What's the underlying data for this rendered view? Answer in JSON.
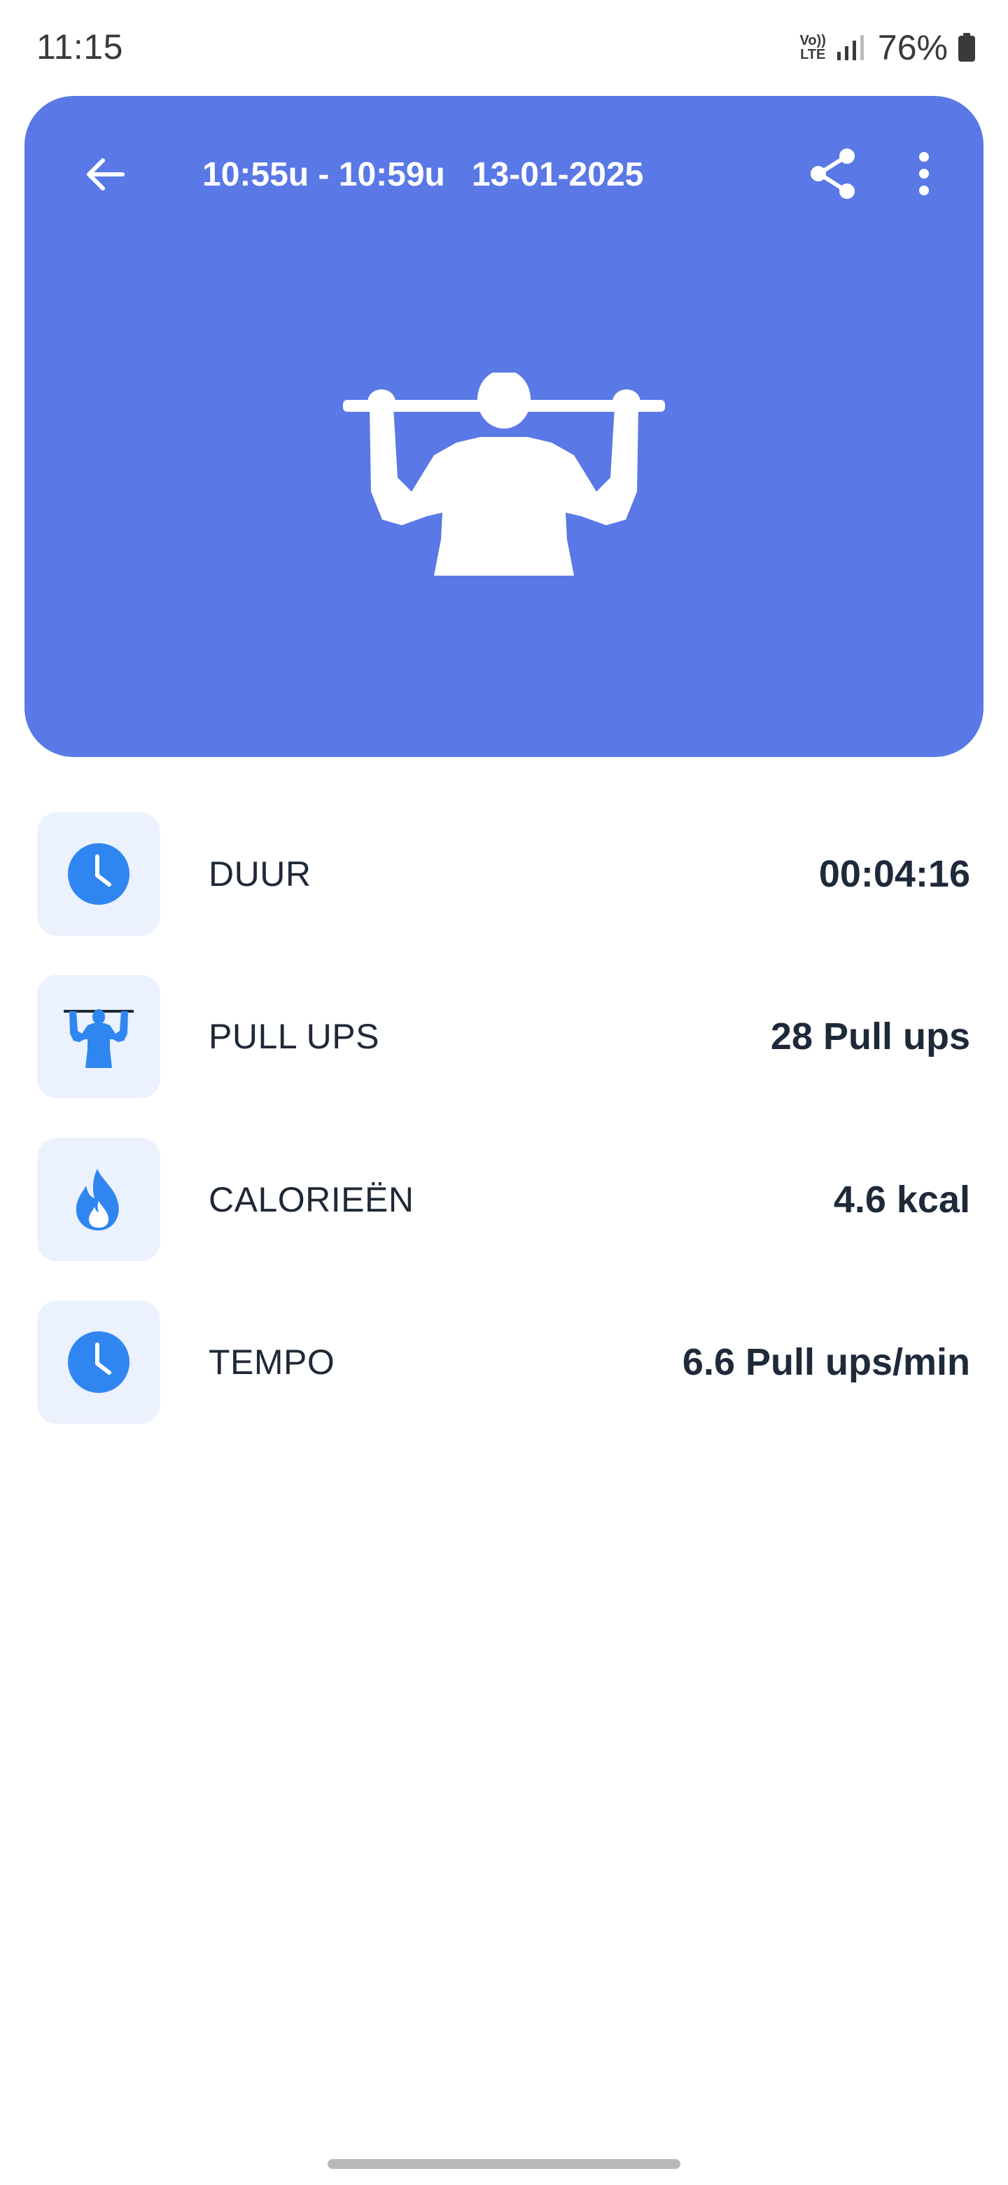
{
  "status_bar": {
    "time": "11:15",
    "volte_top": "Vo))",
    "volte_bottom": "LTE",
    "battery": "76%"
  },
  "header": {
    "time_range": "10:55u - 10:59u",
    "date": "13-01-2025",
    "icons": {
      "back": "arrow-left-icon",
      "share": "share-icon",
      "more": "more-vertical-icon"
    },
    "background_color": "#5a78e6"
  },
  "stats": [
    {
      "label": "DUUR",
      "value": "00:04:16",
      "icon": "clock-icon"
    },
    {
      "label": "PULL UPS",
      "value": "28 Pull ups",
      "icon": "pull-up-icon"
    },
    {
      "label": "CALORIEËN",
      "value": "4.6 kcal",
      "icon": "flame-icon"
    },
    {
      "label": "TEMPO",
      "value": "6.6 Pull ups/min",
      "icon": "clock-icon"
    }
  ],
  "colors": {
    "accent": "#2f86f0",
    "icon_tile": "#ebf1fd"
  }
}
